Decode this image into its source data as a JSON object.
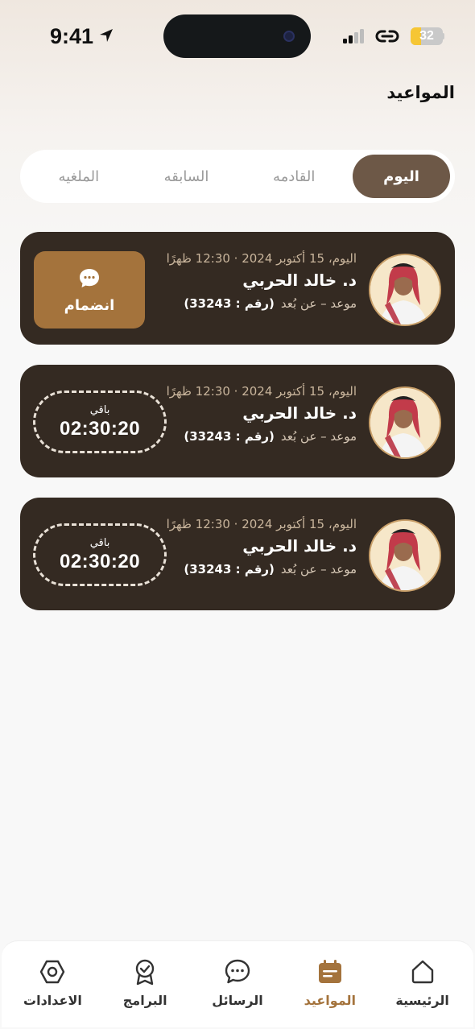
{
  "status_bar": {
    "time": "9:41",
    "battery": "32",
    "battery_level": 0.32
  },
  "page": {
    "title": "المواعيد"
  },
  "tabs": [
    {
      "label": "اليوم",
      "active": true
    },
    {
      "label": "القادمه",
      "active": false
    },
    {
      "label": "السابقه",
      "active": false
    },
    {
      "label": "الملغيه",
      "active": false
    }
  ],
  "appointments": [
    {
      "date": "اليوم، 15 أكتوبر 2024 · 12:30 ظهرًا",
      "doctor": "د. خالد الحربي",
      "type": "موعد – عن بُعد",
      "number": "(رقم : 33243)",
      "action": "join",
      "join_label": "انضمام"
    },
    {
      "date": "اليوم، 15 أكتوبر 2024 · 12:30 ظهرًا",
      "doctor": "د. خالد الحربي",
      "type": "موعد – عن بُعد",
      "number": "(رقم : 33243)",
      "action": "countdown",
      "remaining_label": "باقي",
      "remaining": "02:30:20"
    },
    {
      "date": "اليوم، 15 أكتوبر 2024 · 12:30 ظهرًا",
      "doctor": "د. خالد الحربي",
      "type": "موعد – عن بُعد",
      "number": "(رقم : 33243)",
      "action": "countdown",
      "remaining_label": "باقي",
      "remaining": "02:30:20"
    }
  ],
  "bottom_nav": [
    {
      "label": "الرئيسية",
      "icon": "home-icon",
      "active": false
    },
    {
      "label": "المواعيد",
      "icon": "calendar-icon",
      "active": true
    },
    {
      "label": "الرسائل",
      "icon": "chat-icon",
      "active": false
    },
    {
      "label": "البرامج",
      "icon": "badge-icon",
      "active": false
    },
    {
      "label": "الاعدادات",
      "icon": "settings-icon",
      "active": false
    }
  ],
  "colors": {
    "accent": "#a4733c",
    "card": "#342a22",
    "tab_active": "#6d5847"
  }
}
